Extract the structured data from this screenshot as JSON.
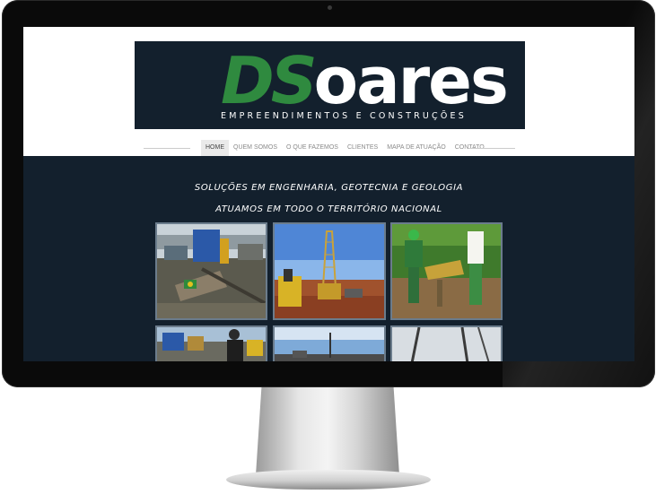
{
  "logo": {
    "part1": "DS",
    "part2": "oares",
    "tagline": "EMPREENDIMENTOS E CONSTRUÇÕES"
  },
  "nav": {
    "items": [
      {
        "label": "HOME",
        "active": true
      },
      {
        "label": "QUEM SOMOS",
        "active": false
      },
      {
        "label": "O QUE FAZEMOS",
        "active": false
      },
      {
        "label": "CLIENTES",
        "active": false
      },
      {
        "label": "MAPA DE ATUAÇÃO",
        "active": false
      },
      {
        "label": "CONTATO",
        "active": false
      }
    ]
  },
  "content": {
    "headline1": "SOLUÇÕES EM ENGENHARIA, GEOTECNIA E GEOLOGIA",
    "headline2": "ATUAMOS EM TODO O TERRITÓRIO NACIONAL"
  },
  "colors": {
    "brand_dark": "#13202d",
    "brand_green": "#2f8a3f"
  }
}
